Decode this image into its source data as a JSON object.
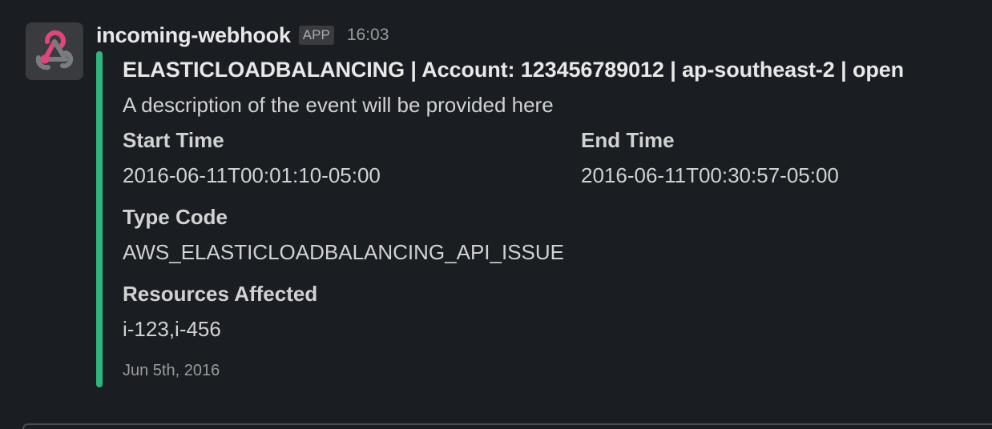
{
  "message": {
    "sender": "incoming-webhook",
    "badge": "APP",
    "time": "16:03",
    "avatar_icon": "webhook-icon",
    "accent_color": "#2eb67d"
  },
  "attachment": {
    "title": "ELASTICLOADBALANCING | Account: 123456789012 | ap-southeast-2 | open",
    "text": "A description of the event will be provided here",
    "fields": [
      {
        "title": "Start Time",
        "value": "2016-06-11T00:01:10-05:00"
      },
      {
        "title": "End Time",
        "value": "2016-06-11T00:30:57-05:00"
      },
      {
        "title": "Type Code",
        "value": "AWS_ELASTICLOADBALANCING_API_ISSUE"
      },
      {
        "title": "Resources Affected",
        "value": "i-123,i-456"
      }
    ],
    "footer": "Jun 5th, 2016"
  }
}
